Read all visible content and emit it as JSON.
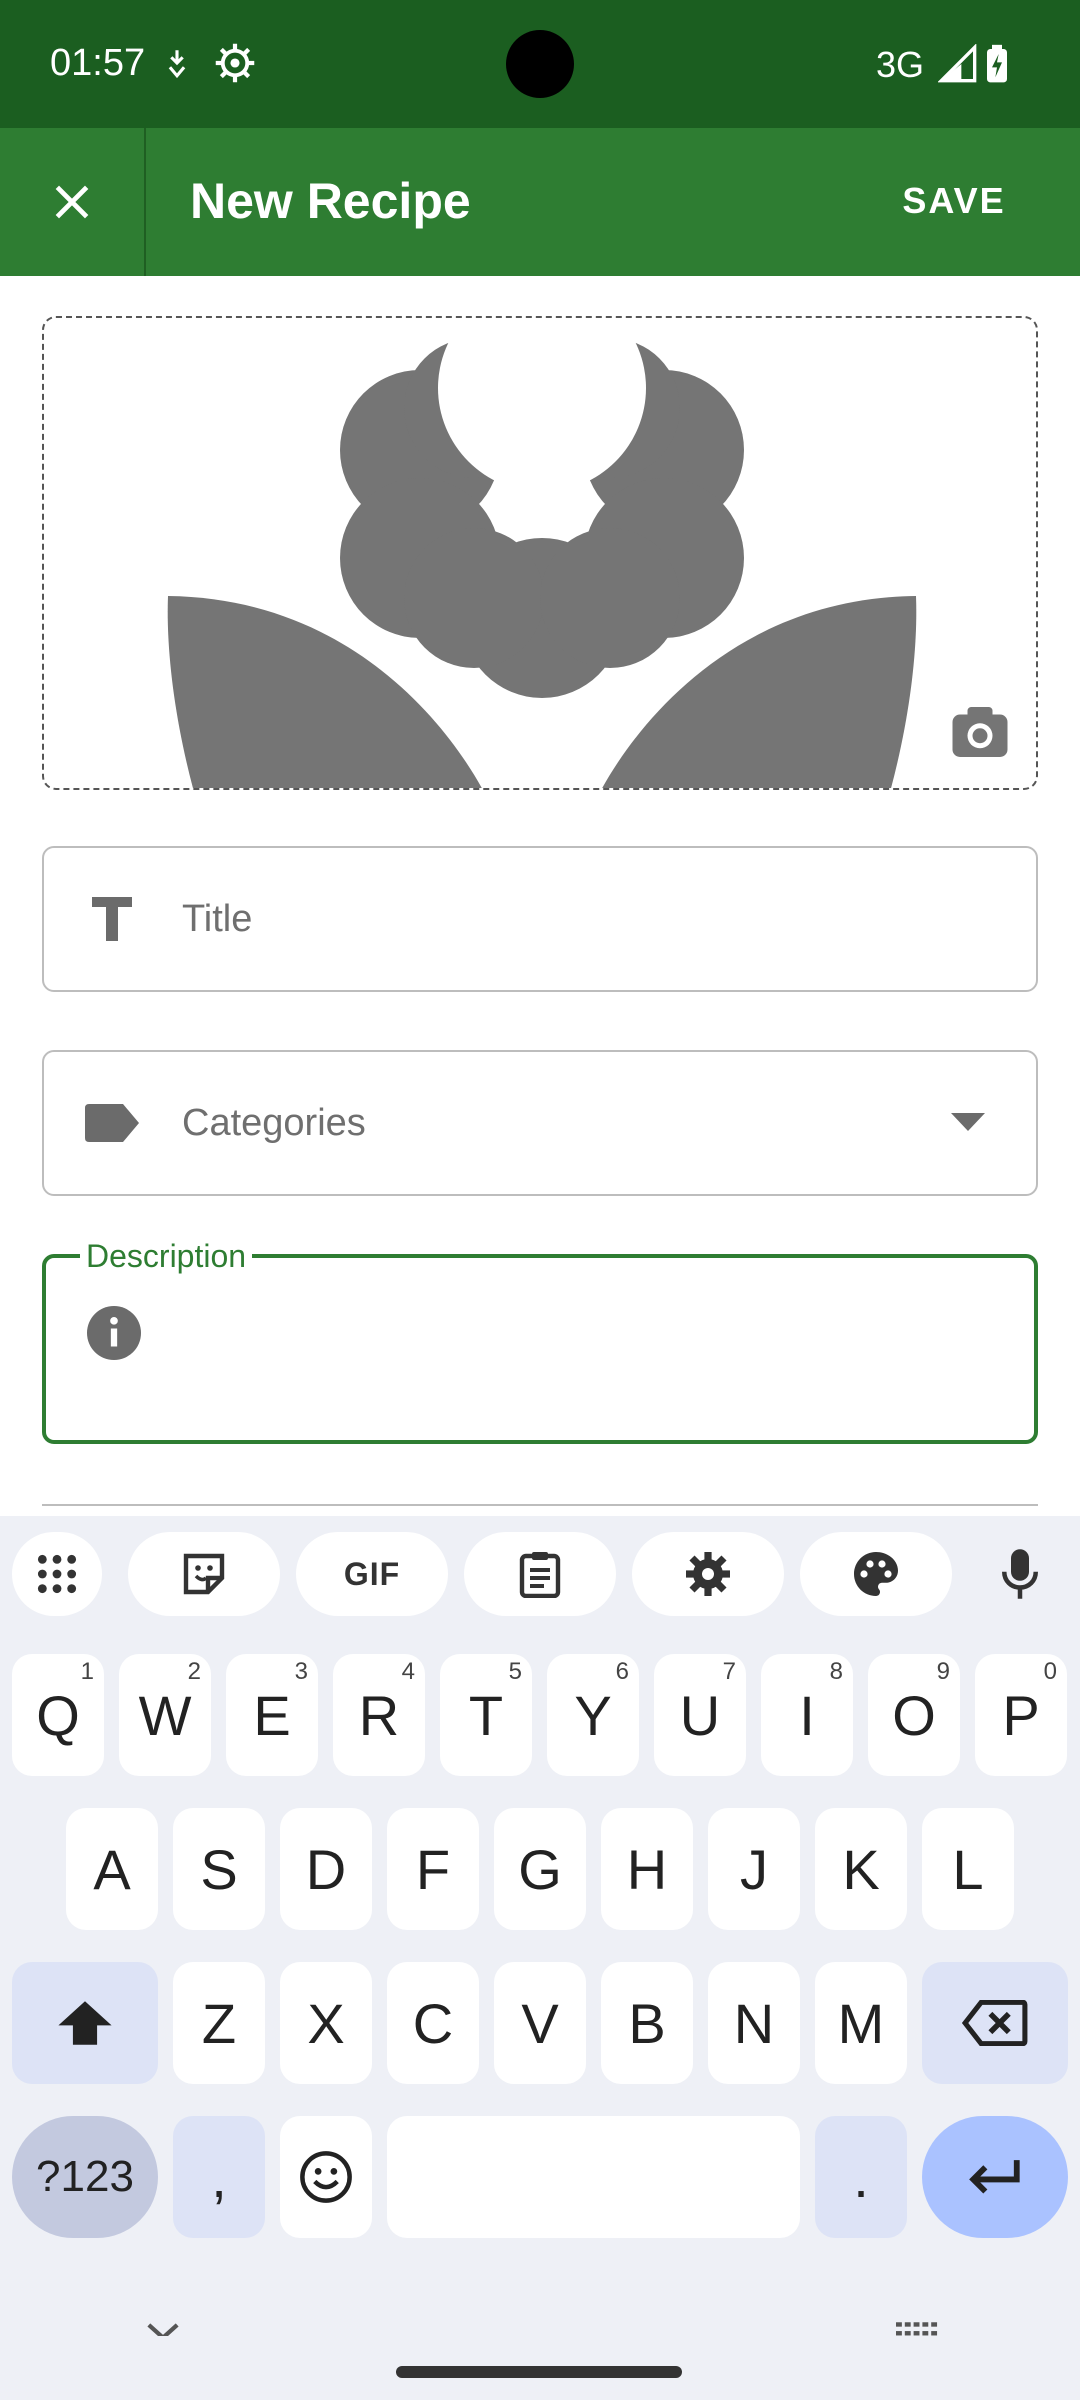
{
  "status_bar": {
    "time": "01:57",
    "network": "3G",
    "icons": [
      "downloading-icon",
      "settings-gear-icon",
      "signal-icon",
      "battery-charging-icon"
    ]
  },
  "app_bar": {
    "title": "New Recipe",
    "save_label": "SAVE",
    "close_icon": "close-icon",
    "color": "#2e7d32"
  },
  "image": {
    "placeholder_icon": "flower-placeholder-icon",
    "camera_icon": "camera-icon"
  },
  "fields": {
    "title": {
      "placeholder": "Title",
      "icon": "title-text-icon"
    },
    "categories": {
      "placeholder": "Categories",
      "icon": "label-tag-icon",
      "dropdown_icon": "dropdown-arrow-icon"
    },
    "description": {
      "label": "Description",
      "icon": "info-icon"
    }
  },
  "keyboard": {
    "toolbar": [
      "apps-grid-icon",
      "sticker-icon",
      "GIF",
      "clipboard-icon",
      "settings-icon",
      "palette-icon",
      "mic-icon"
    ],
    "row1": [
      {
        "key": "Q",
        "hint": "1"
      },
      {
        "key": "W",
        "hint": "2"
      },
      {
        "key": "E",
        "hint": "3"
      },
      {
        "key": "R",
        "hint": "4"
      },
      {
        "key": "T",
        "hint": "5"
      },
      {
        "key": "Y",
        "hint": "6"
      },
      {
        "key": "U",
        "hint": "7"
      },
      {
        "key": "I",
        "hint": "8"
      },
      {
        "key": "O",
        "hint": "9"
      },
      {
        "key": "P",
        "hint": "0"
      }
    ],
    "row2": [
      "A",
      "S",
      "D",
      "F",
      "G",
      "H",
      "J",
      "K",
      "L"
    ],
    "row3": [
      "Z",
      "X",
      "C",
      "V",
      "B",
      "N",
      "M"
    ],
    "symbols_label": "?123",
    "comma": ",",
    "period": ".",
    "accent": "#aac2ff"
  }
}
